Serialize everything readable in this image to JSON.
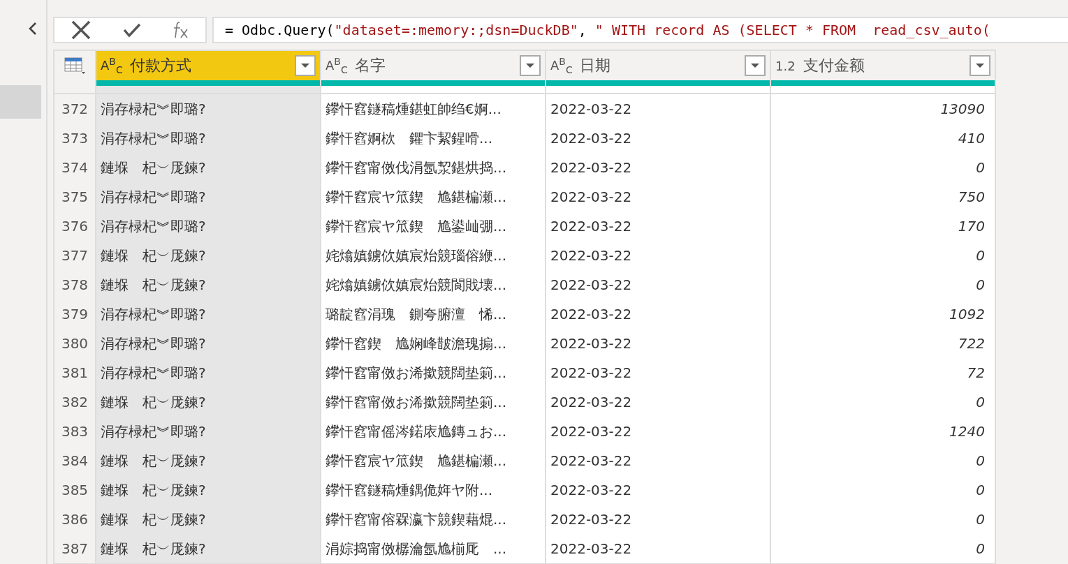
{
  "formula_bar": {
    "parts": [
      {
        "kind": "code",
        "text": "= Odbc.Query("
      },
      {
        "kind": "string",
        "text": "\"dataset=:memory:;dsn=DuckDB\""
      },
      {
        "kind": "code",
        "text": ", "
      },
      {
        "kind": "string",
        "text": "\" WITH record AS (SELECT * FROM  read_csv_auto("
      }
    ]
  },
  "table": {
    "columns": [
      {
        "type_label": "A$^{B}$$_{C}$",
        "name": "付款方式",
        "selected": true,
        "kind": "text"
      },
      {
        "type_label": "A$^{B}$$_{C}$",
        "name": "名字",
        "selected": false,
        "kind": "text"
      },
      {
        "type_label": "A$^{B}$$_{C}$",
        "name": "日期",
        "selected": false,
        "kind": "text"
      },
      {
        "type_label": "1.2",
        "name": "支付金额",
        "selected": false,
        "kind": "number"
      }
    ],
    "rows": [
      {
        "index": "372",
        "cells": [
          "涓存椂杞︾即璐?",
          "鑻忓窞鐩稿煄鍖虹帥绉€婀...",
          "2022-03-22",
          "13090"
        ]
      },
      {
        "index": "373",
        "cells": [
          "涓存椂杞︾即璐?",
          "鑻忓窞婀栨　鑺卞絜鍟嗗...",
          "2022-03-22",
          "410"
        ]
      },
      {
        "index": "374",
        "cells": [
          "鏈堢　杞︶厐鍊?",
          "鑻忓窞甯傚伐涓氬洯鍖烘捣...",
          "2022-03-22",
          "0"
        ]
      },
      {
        "index": "375",
        "cells": [
          "涓存椂杞︾即璐?",
          "鑻忓窞宸ヤ笟鍥　尯鍖楄瀬...",
          "2022-03-22",
          "750"
        ]
      },
      {
        "index": "376",
        "cells": [
          "涓存椂杞︾即璐?",
          "鑻忓窞宸ヤ笟鍥　尯鍙屾弸...",
          "2022-03-22",
          "170"
        ]
      },
      {
        "index": "377",
        "cells": [
          "鏈堢　杞︶厐鍊?",
          "姹熻嫃鐪佽嫃宸炲競瑙傛緶...",
          "2022-03-22",
          "0"
        ]
      },
      {
        "index": "378",
        "cells": [
          "鏈堢　杞︶厐鍊?",
          "姹熻嫃鐪佽嫃宸炲競閬戝壊...",
          "2022-03-22",
          "0"
        ]
      },
      {
        "index": "379",
        "cells": [
          "涓存椂杞︾即璐?",
          "璐靛窞涓瑰　鍘夸腑澶　悕...",
          "2022-03-22",
          "1092"
        ]
      },
      {
        "index": "380",
        "cells": [
          "涓存椂杞︾即璐?",
          "鑻忓窞鍥　尯娴峰皵澹瑰搧...",
          "2022-03-22",
          "722"
        ]
      },
      {
        "index": "381",
        "cells": [
          "涓存椂杞︾即璐?",
          "鑻忓窞甯傚お浠撳競闊垫箣...",
          "2022-03-22",
          "72"
        ]
      },
      {
        "index": "382",
        "cells": [
          "鏈堢　杞︶厐鍊?",
          "鑻忓窞甯傚お浠撳競闊垫箣...",
          "2022-03-22",
          "0"
        ]
      },
      {
        "index": "383",
        "cells": [
          "涓存椂杞︾即璐?",
          "鑻忓窞甯傜涔鍩庡尯鏄ュお...",
          "2022-03-22",
          "1240"
        ]
      },
      {
        "index": "384",
        "cells": [
          "鏈堢　杞︶厐鍊?",
          "鑻忓窞宸ヤ笟鍥　尯鍖楄瀬...",
          "2022-03-22",
          "0"
        ]
      },
      {
        "index": "385",
        "cells": [
          "鏈堢　杞︶厐鍊?",
          "鑻忓窞鐩稿煄鍝佹姩ヤ附...",
          "2022-03-22",
          "0"
        ]
      },
      {
        "index": "386",
        "cells": [
          "鏈堢　杞︶厐鍊?",
          "鑻忓窞甯傛槑瀛卞競鍥藉焜...",
          "2022-03-22",
          "0"
        ]
      },
      {
        "index": "387",
        "cells": [
          "鏈堢　杞︶厐鍊?",
          "涓婃捣甯傚樼瀹氬尯椾厑　...",
          "2022-03-22",
          "0"
        ]
      }
    ]
  }
}
